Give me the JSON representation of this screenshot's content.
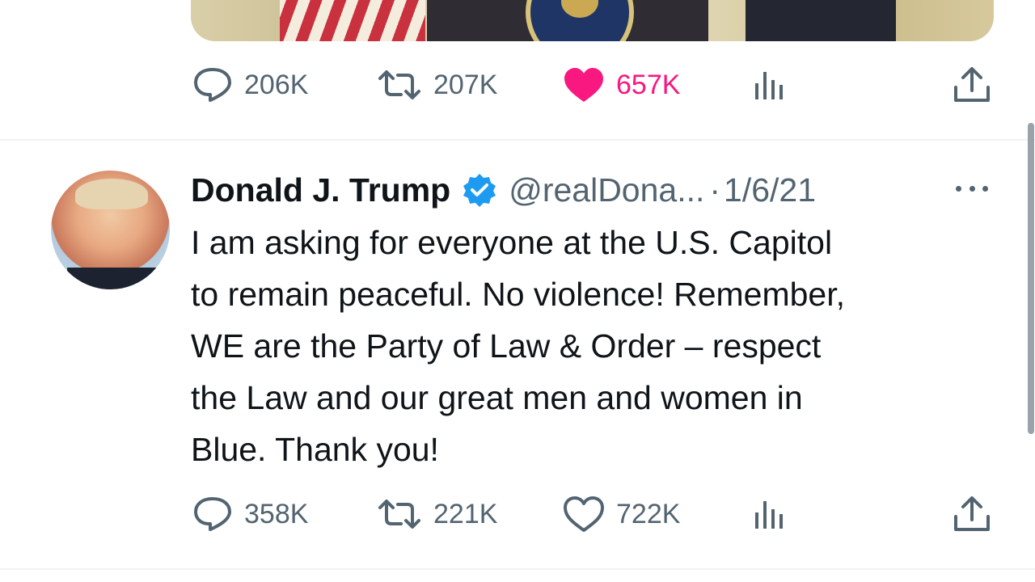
{
  "previous_tweet": {
    "actions": {
      "replies": "206K",
      "retweets": "207K",
      "likes": "657K",
      "like_color": "#f91880"
    }
  },
  "tweet": {
    "display_name": "Donald J. Trump",
    "verified": true,
    "verified_color": "#1d9bf0",
    "handle": "@realDona...",
    "separator": "·",
    "date": "1/6/21",
    "text": "I am asking for everyone at the U.S. Capitol\nto remain peaceful. No violence! Remember,\nWE are the Party of Law & Order – respect\nthe Law and our great men and women in\nBlue. Thank you!",
    "actions": {
      "replies": "358K",
      "retweets": "221K",
      "likes": "722K"
    }
  },
  "colors": {
    "text_primary": "#0f1419",
    "text_secondary": "#536471",
    "divider": "#eff3f4"
  },
  "icons": [
    "reply-icon",
    "retweet-icon",
    "like-icon",
    "views-icon",
    "share-icon",
    "verified-badge-icon",
    "more-options-icon"
  ]
}
